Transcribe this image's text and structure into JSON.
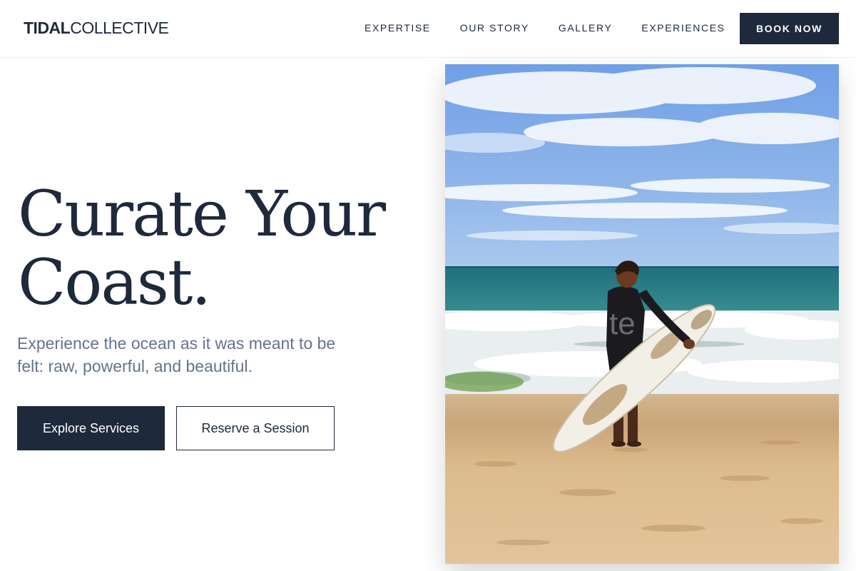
{
  "brand": {
    "bold": "TIDAL",
    "light": "COLLECTIVE"
  },
  "nav": {
    "items": [
      {
        "label": "EXPERTISE"
      },
      {
        "label": "OUR STORY"
      },
      {
        "label": "GALLERY"
      },
      {
        "label": "EXPERIENCES"
      }
    ],
    "cta_label": "BOOK NOW"
  },
  "hero": {
    "title_line1": "Curate Your",
    "title_line2": "Coast.",
    "subtitle": "Experience the ocean as it was meant to be felt: raw, powerful, and beautiful.",
    "primary_button": "Explore Services",
    "secondary_button": "Reserve a Session"
  },
  "photo": {
    "subject": "surfer-holding-surfboard-on-beach",
    "wetsuit_text": "te surf"
  },
  "colors": {
    "navy": "#1e293b",
    "slate": "#64748b",
    "sky": "#6fa3e0",
    "sea": "#2f7f86",
    "sand": "#d9b88a"
  }
}
